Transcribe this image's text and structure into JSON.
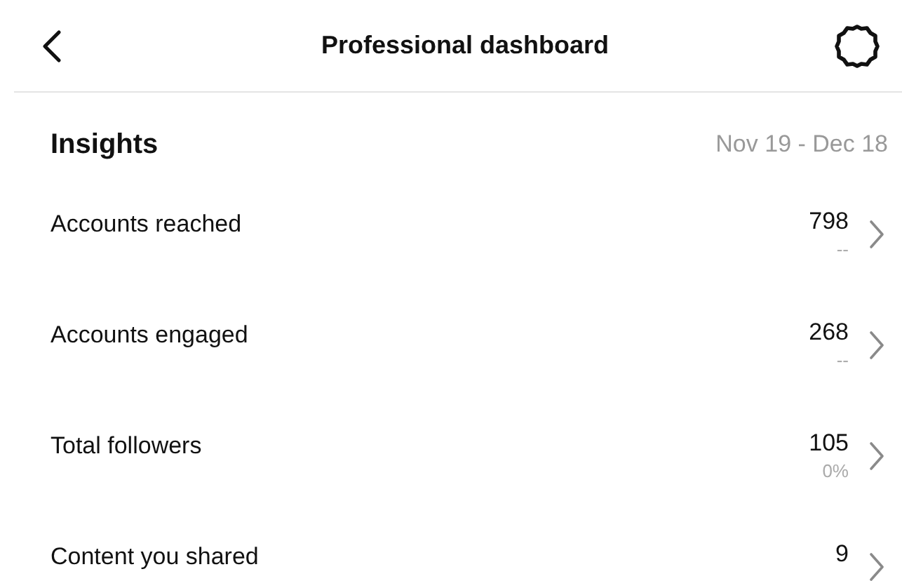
{
  "header": {
    "title": "Professional dashboard"
  },
  "insights": {
    "title": "Insights",
    "date_range": "Nov 19 - Dec 18"
  },
  "metrics": [
    {
      "label": "Accounts reached",
      "value": "798",
      "change": "--"
    },
    {
      "label": "Accounts engaged",
      "value": "268",
      "change": "--"
    },
    {
      "label": "Total followers",
      "value": "105",
      "change": "0%"
    },
    {
      "label": "Content you shared",
      "value": "9"
    }
  ]
}
